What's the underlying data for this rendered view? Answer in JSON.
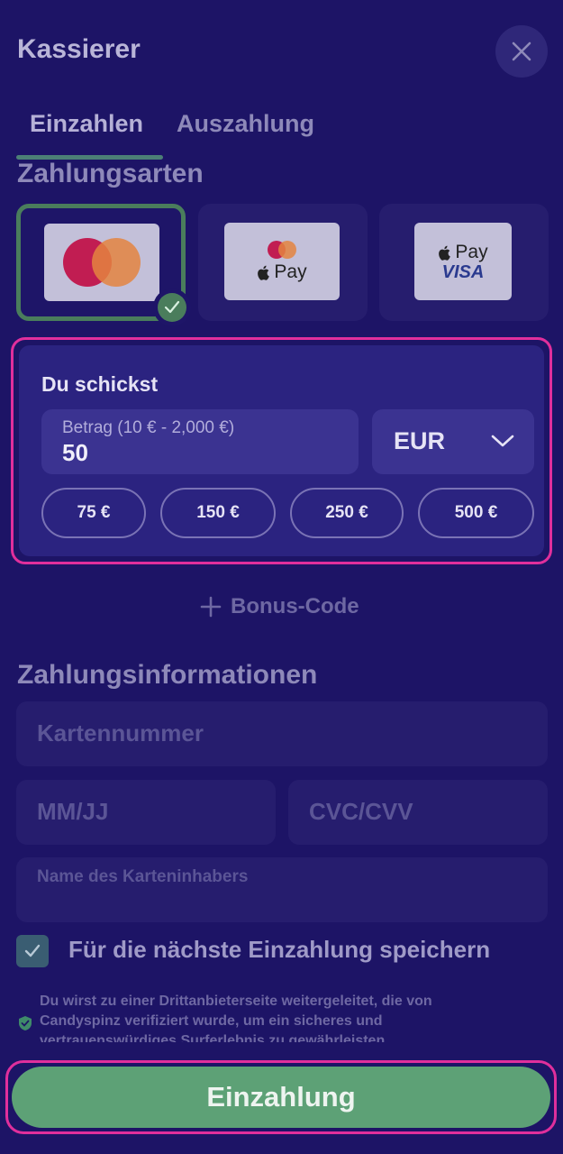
{
  "header": {
    "title": "Kassierer"
  },
  "tabs": {
    "deposit": "Einzahlen",
    "withdraw": "Auszahlung"
  },
  "payment_methods": {
    "title": "Zahlungsarten",
    "items": [
      {
        "name": "Mastercard",
        "selected": true
      },
      {
        "name": "Mastercard Apple Pay",
        "label": "Pay",
        "selected": false
      },
      {
        "name": "Apple Pay Visa",
        "label": "Pay",
        "brand": "VISA",
        "selected": false
      }
    ]
  },
  "send": {
    "label": "Du schickst",
    "amount_label": "Betrag (10 € - 2,000 €)",
    "amount_value": "50",
    "currency": "EUR",
    "presets": [
      "75 €",
      "150 €",
      "250 €",
      "500 €"
    ]
  },
  "bonus": {
    "label": "Bonus-Code"
  },
  "payment_info": {
    "title": "Zahlungsinformationen",
    "card_number_placeholder": "Kartennummer",
    "expiry_placeholder": "MM/JJ",
    "cvc_placeholder": "CVC/CVV",
    "holder_placeholder": "Name des Karteninhabers"
  },
  "save": {
    "label": "Für die nächste Einzahlung speichern",
    "checked": true
  },
  "notice": {
    "text": "Du wirst zu einer Drittanbieterseite weitergeleitet, die von Candyspinz verifiziert wurde, um ein sicheres und vertrauenswürdiges Surferlebnis zu gewährleisten."
  },
  "cta": {
    "label": "Einzahlung"
  },
  "colors": {
    "background": "#1d1466",
    "panel": "#2b2380",
    "accent_green": "#5da176",
    "highlight_pink": "#e02f9c"
  }
}
